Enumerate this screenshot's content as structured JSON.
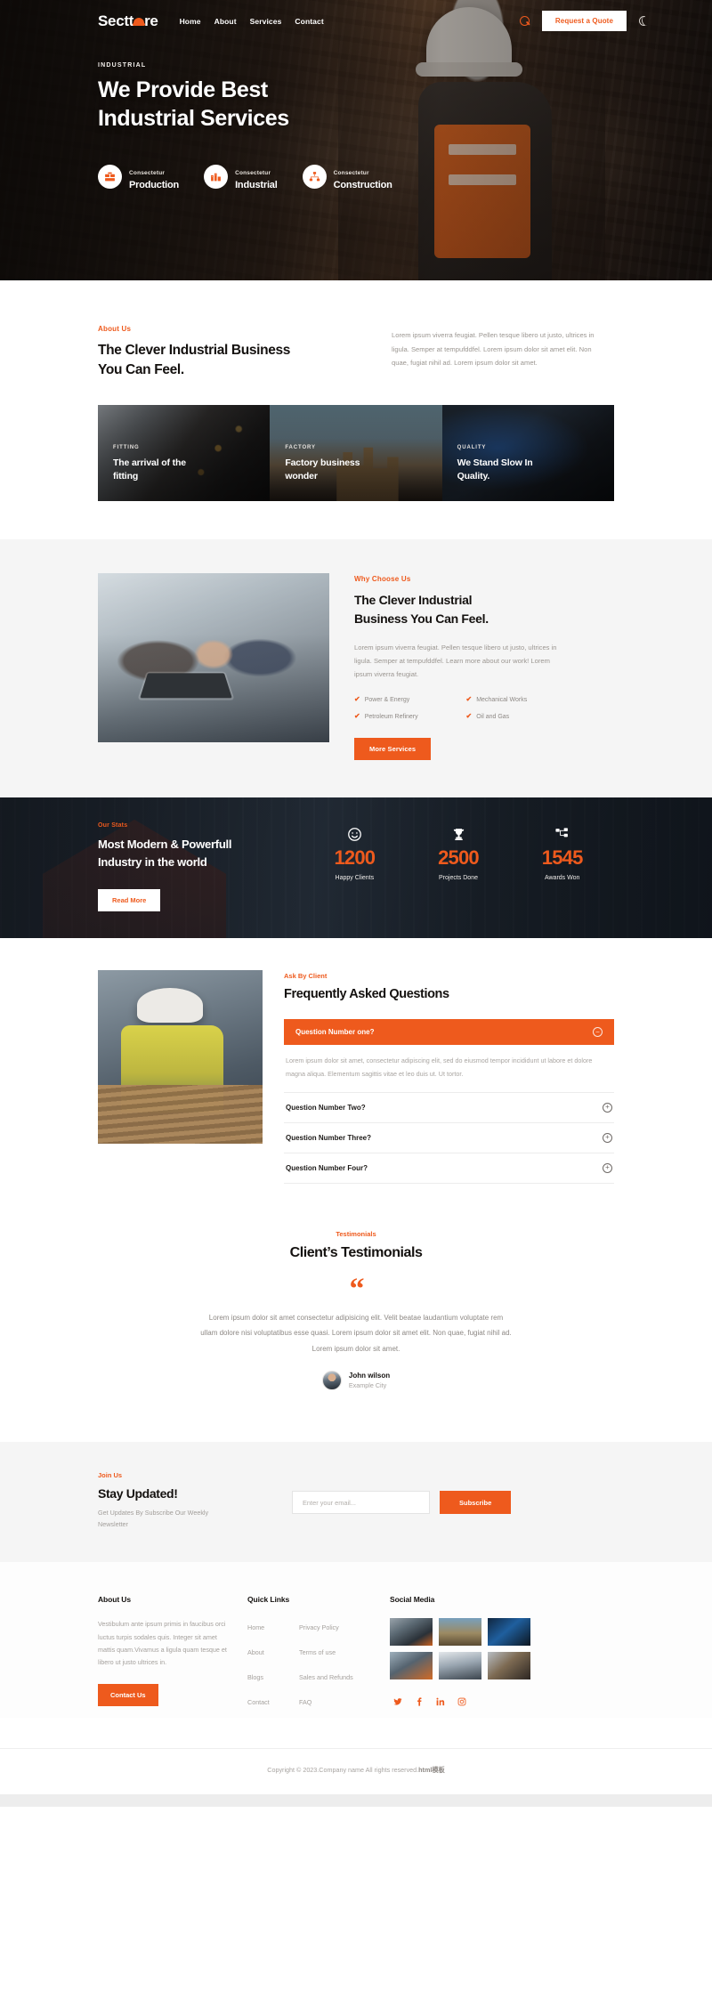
{
  "header": {
    "logo_text": "Sectt",
    "logo_text_end": "re",
    "nav": [
      {
        "label": "Home"
      },
      {
        "label": "About"
      },
      {
        "label": "Services"
      },
      {
        "label": "Contact"
      }
    ],
    "search_icon": "search-icon",
    "quote_button": "Request a Quote",
    "theme_toggle_icon": "moon-icon"
  },
  "hero": {
    "eyebrow": "INDUSTRIAL",
    "title_line1": "We Provide Best",
    "title_line2": "Industrial Services",
    "services": [
      {
        "eyebrow": "Consectetur",
        "name": "Production",
        "icon": "bricks-icon"
      },
      {
        "eyebrow": "Consectetur",
        "name": "Industrial",
        "icon": "factory-icon"
      },
      {
        "eyebrow": "Consectetur",
        "name": "Construction",
        "icon": "sitemap-icon"
      }
    ]
  },
  "about": {
    "eyebrow": "About Us",
    "title_line1": "The Clever Industrial Business",
    "title_line2": "You Can Feel.",
    "paragraph": "Lorem ipsum viverra feugiat. Pellen tesque libero ut justo, ultrices in ligula. Semper at tempufddfel. Lorem ipsum dolor sit amet elit. Non quae, fugiat nihil ad. Lorem ipsum dolor sit amet."
  },
  "cards": [
    {
      "eyebrow": "FITTING",
      "title": "The arrival of the fitting"
    },
    {
      "eyebrow": "FACTORY",
      "title": "Factory business wonder"
    },
    {
      "eyebrow": "QUALITY",
      "title": "We Stand Slow In Quality."
    }
  ],
  "why": {
    "eyebrow": "Why Choose Us",
    "title_line1": "The Clever Industrial",
    "title_line2": "Business You Can Feel.",
    "paragraph": "Lorem ipsum viverra feugiat. Pellen tesque libero ut justo, ultrices in ligula. Semper at tempufddfel. Learn more about our work! Lorem ipsum viverra feugiat.",
    "features": [
      "Power & Energy",
      "Mechanical Works",
      "Petroleum Refinery",
      "Oil and Gas"
    ],
    "button": "More Services",
    "image_alt": "team-working-on-laptop"
  },
  "stats": {
    "eyebrow": "Our Stats",
    "title_line1": "Most Modern & Powerfull",
    "title_line2": "Industry in the world",
    "button": "Read More",
    "items": [
      {
        "icon": "smiley-icon",
        "value": "1200",
        "label": "Happy Clients"
      },
      {
        "icon": "trophy-icon",
        "value": "2500",
        "label": "Projects Done"
      },
      {
        "icon": "network-icon",
        "value": "1545",
        "label": "Awards Won"
      }
    ]
  },
  "faq": {
    "eyebrow": "Ask By Client",
    "title": "Frequently Asked Questions",
    "image_alt": "worker-carrying-plank",
    "open_item": {
      "question": "Question Number one?",
      "toggle_icon": "minus-circle-icon",
      "answer": "Lorem ipsum dolor sit amet, consectetur adipiscing elit, sed do eiusmod tempor incididunt ut labore et dolore magna aliqua. Elementum sagittis vitae et leo duis ut. Ut tortor."
    },
    "items": [
      {
        "question": "Question Number Two?",
        "toggle_icon": "plus-circle-icon"
      },
      {
        "question": "Question Number Three?",
        "toggle_icon": "plus-circle-icon"
      },
      {
        "question": "Question Number Four?",
        "toggle_icon": "plus-circle-icon"
      }
    ]
  },
  "testimonials": {
    "eyebrow": "Testimonials",
    "title": "Client’s Testimonials",
    "quote_icon": "quote-mark-icon",
    "text": "Lorem ipsum dolor sit amet consectetur adipisicing elit. Velit beatae laudantium voluptate rem ullam dolore nisi voluptatibus esse quasi. Lorem ipsum dolor sit amet elit. Non quae, fugiat nihil ad. Lorem ipsum dolor sit amet.",
    "author_name": "John wilson",
    "author_city": "Example City"
  },
  "newsletter": {
    "eyebrow": "Join Us",
    "title": "Stay Updated!",
    "subtitle": "Get Updates By Subscribe Our Weekly Newsletter",
    "placeholder": "Enter your email...",
    "button": "Subscribe"
  },
  "footer": {
    "about_heading": "About Us",
    "about_text": "Vestibulum ante ipsum primis in faucibus orci luctus turpis sodales quis. Integer sit amet mattis quam.Vivamus a ligula quam tesque et libero ut justo ultrices in.",
    "contact_button": "Contact Us",
    "quick_links_heading": "Quick Links",
    "quick_links_col1": [
      {
        "label": "Home"
      },
      {
        "label": "About"
      },
      {
        "label": "Blogs"
      },
      {
        "label": "Contact"
      }
    ],
    "quick_links_col2": [
      {
        "label": "Privacy Policy"
      },
      {
        "label": "Terms of use"
      },
      {
        "label": "Sales and Refunds"
      },
      {
        "label": "FAQ"
      }
    ],
    "social_heading": "Social Media",
    "thumbnails": [
      {
        "alt": "workers-on-site"
      },
      {
        "alt": "factory-silos"
      },
      {
        "alt": "night-industrial"
      },
      {
        "alt": "scaffolding-workers"
      },
      {
        "alt": "team-meeting"
      },
      {
        "alt": "crane-operation"
      }
    ],
    "social_icons": [
      {
        "name": "twitter-icon"
      },
      {
        "name": "facebook-icon"
      },
      {
        "name": "linkedin-icon"
      },
      {
        "name": "instagram-icon"
      }
    ],
    "copyright_prefix": "Copyright © 2023.Company name All rights reserved.",
    "copyright_suffix": "html模板"
  },
  "colors": {
    "accent": "#ee5a1d",
    "dark": "#14110f",
    "muted": "#a5a19d",
    "panel": "#f5f5f5"
  }
}
